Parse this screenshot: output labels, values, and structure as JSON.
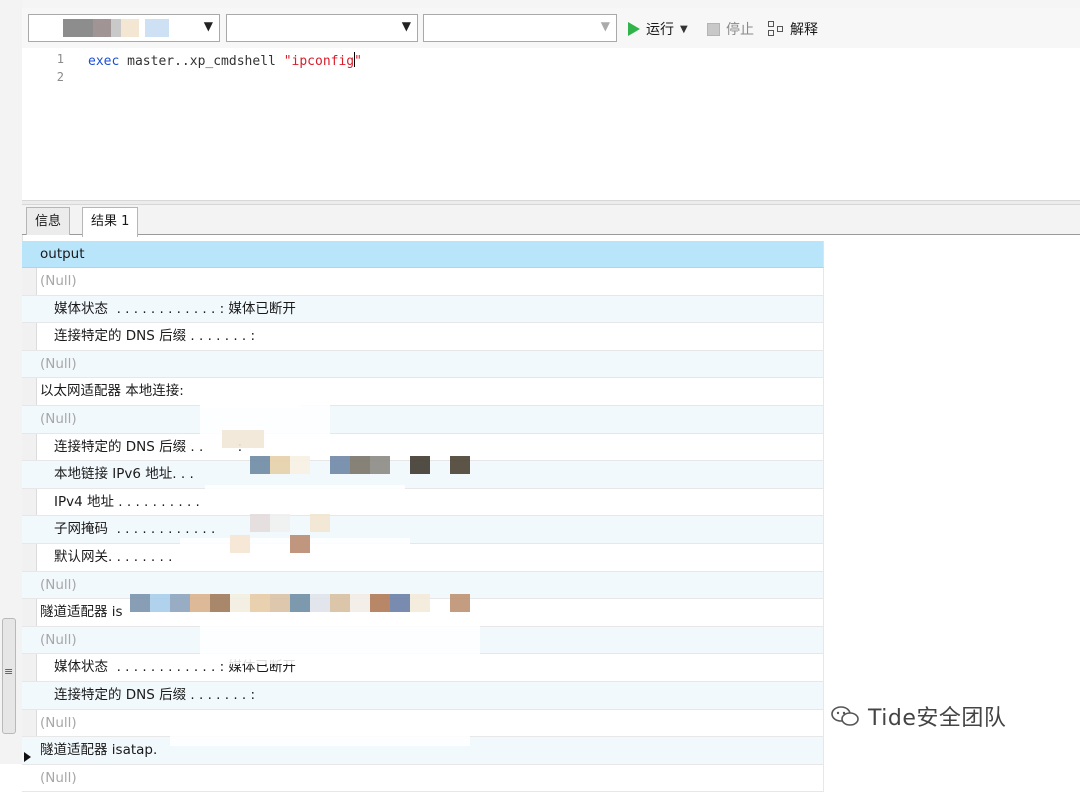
{
  "toolbar": {
    "run_label": "运行",
    "stop_label": "停止",
    "explain_label": "解释"
  },
  "editor": {
    "lines": [
      "1",
      "2"
    ],
    "code": {
      "keyword": "exec",
      "body": " master..xp_cmdshell ",
      "string_a": "\"ipconfig",
      "string_b": "\""
    }
  },
  "tabs": [
    {
      "label": "信息"
    },
    {
      "label": "结果 1"
    }
  ],
  "grid": {
    "column": "output",
    "rows": [
      "(Null)",
      "媒体状态  . . . . . . . . . . . . : 媒体已断开",
      "连接特定的 DNS 后缀 . . . . . . . :",
      "(Null)",
      "以太网适配器 本地连接:",
      "(Null)",
      "连接特定的 DNS 后缀 . .        :",
      "本地链接 IPv6 地址. . .",
      "IPv4 地址 . . . . . . . . . .",
      "子网掩码  . . . . . . . . . . . .",
      "默认网关. . . . . . . .",
      "(Null)",
      "隧道适配器 is",
      "(Null)",
      "媒体状态  . . . . . . . . . . . . : 媒体已断开",
      "连接特定的 DNS 后缀 . . . . . . . :",
      "(Null)",
      "隧道适配器 isatap.",
      "(Null)"
    ]
  },
  "watermark": {
    "text": "Tide安全团队"
  },
  "colors": {
    "run_green": "#2fb34a",
    "header_blue": "#b9e5fb",
    "keyword_blue": "#1d4fd4",
    "string_red": "#d81e2a"
  }
}
